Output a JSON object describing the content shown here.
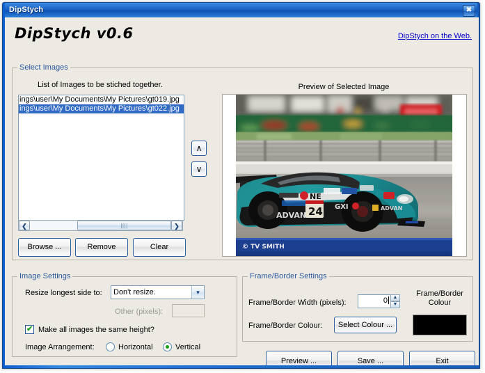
{
  "window": {
    "title": "DipStych",
    "close_label": "✖"
  },
  "header": {
    "app_title": "DipStych v0.6",
    "web_link": "DipStych on the Web."
  },
  "select_images": {
    "group_label": "Select Images",
    "list_caption": "List of Images to be stiched together.",
    "items": [
      {
        "path": "ings\\user\\My Documents\\My Pictures\\gt019.jpg",
        "selected": false
      },
      {
        "path": "ings\\user\\My Documents\\My Pictures\\gt022.jpg",
        "selected": true
      }
    ],
    "scroll": {
      "left_arrow": "❮",
      "right_arrow": "❯",
      "thumb_grip": "||||"
    },
    "move_up_label": "∧",
    "move_down_label": "∨",
    "buttons": {
      "browse": "Browse ...",
      "remove": "Remove",
      "clear": "Clear"
    },
    "preview_caption": "Preview of Selected Image",
    "preview_watermark": "© TV SMITH",
    "preview_car_number": "24",
    "preview_car_sponsor": "ADVAN"
  },
  "image_settings": {
    "group_label": "Image Settings",
    "resize_label": "Resize longest side to:",
    "resize_value": "Don't resize.",
    "resize_options": [
      "Don't resize."
    ],
    "combo_arrow": "▾",
    "other_label": "Other (pixels):",
    "other_value": "",
    "same_height_label": "Make all images the same height?",
    "same_height_checked": true,
    "arrangement_label": "Image Arrangement:",
    "arrangement_options": [
      {
        "label": "Horizontal",
        "selected": false
      },
      {
        "label": "Vertical",
        "selected": true
      }
    ]
  },
  "frame_settings": {
    "group_label": "Frame/Border Settings",
    "width_label": "Frame/Border Width (pixels):",
    "width_value": "0",
    "spin_up": "▲",
    "spin_down": "▼",
    "colour_label": "Frame/Border Colour:",
    "select_colour_button": "Select Colour ...",
    "swatch_caption_line1": "Frame/Border",
    "swatch_caption_line2": "Colour",
    "swatch_colour": "#000000"
  },
  "actions": {
    "preview": "Preview ...",
    "save": "Save ...",
    "exit": "Exit"
  },
  "colors": {
    "titlebar_blue": "#1b62c4",
    "link_blue": "#0000cc",
    "group_label_blue": "#2c5a9e",
    "selection_blue": "#316ac5",
    "check_green": "#18a018",
    "face": "#eceae3"
  }
}
